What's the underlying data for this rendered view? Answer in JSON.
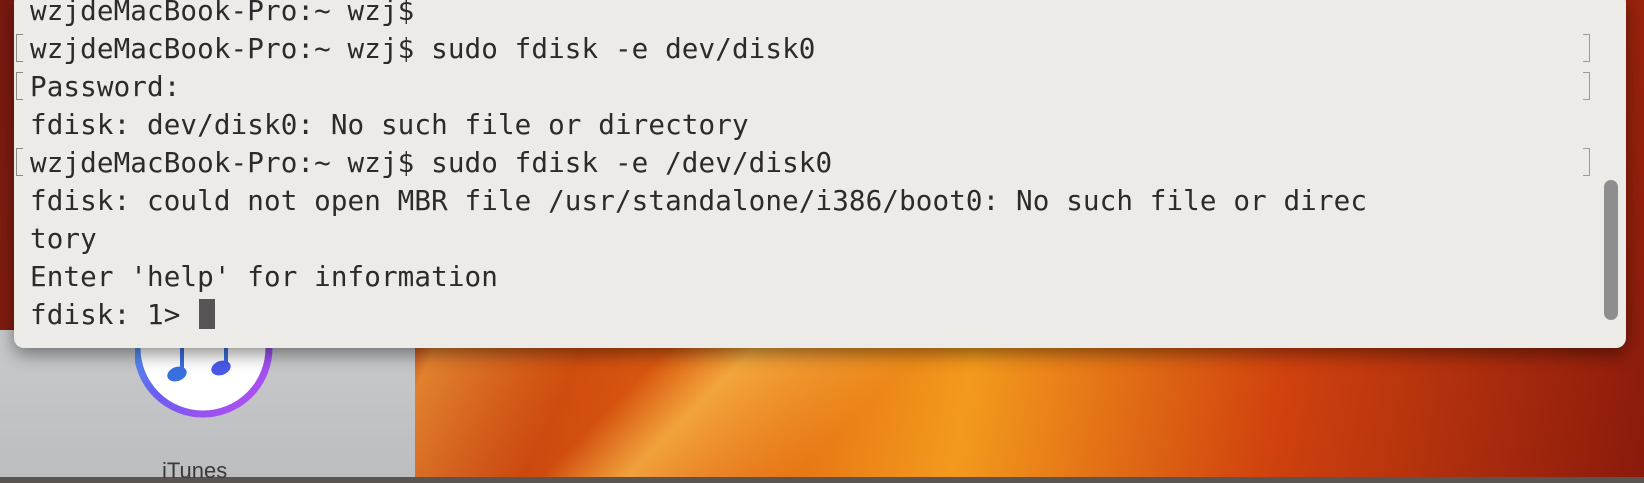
{
  "terminal": {
    "lines": [
      {
        "text": "wzjdeMacBook-Pro:~ wzj$"
      },
      {
        "text": "wzjdeMacBook-Pro:~ wzj$ sudo fdisk -e dev/disk0"
      },
      {
        "text": "Password:"
      },
      {
        "text": "fdisk: dev/disk0: No such file or directory"
      },
      {
        "text": "wzjdeMacBook-Pro:~ wzj$ sudo fdisk -e /dev/disk0"
      },
      {
        "text": "fdisk: could not open MBR file /usr/standalone/i386/boot0: No such file or direc"
      },
      {
        "text": "tory"
      },
      {
        "text": "Enter 'help' for information"
      },
      {
        "text": "fdisk: 1> "
      }
    ]
  },
  "desktop": {
    "itunes_label": "iTunes",
    "itunes_icon": "itunes-icon"
  },
  "colors": {
    "terminal_bg": "#ecebe8",
    "terminal_text": "#2b2b2b",
    "itunes_accent": "#2f6fe8"
  }
}
